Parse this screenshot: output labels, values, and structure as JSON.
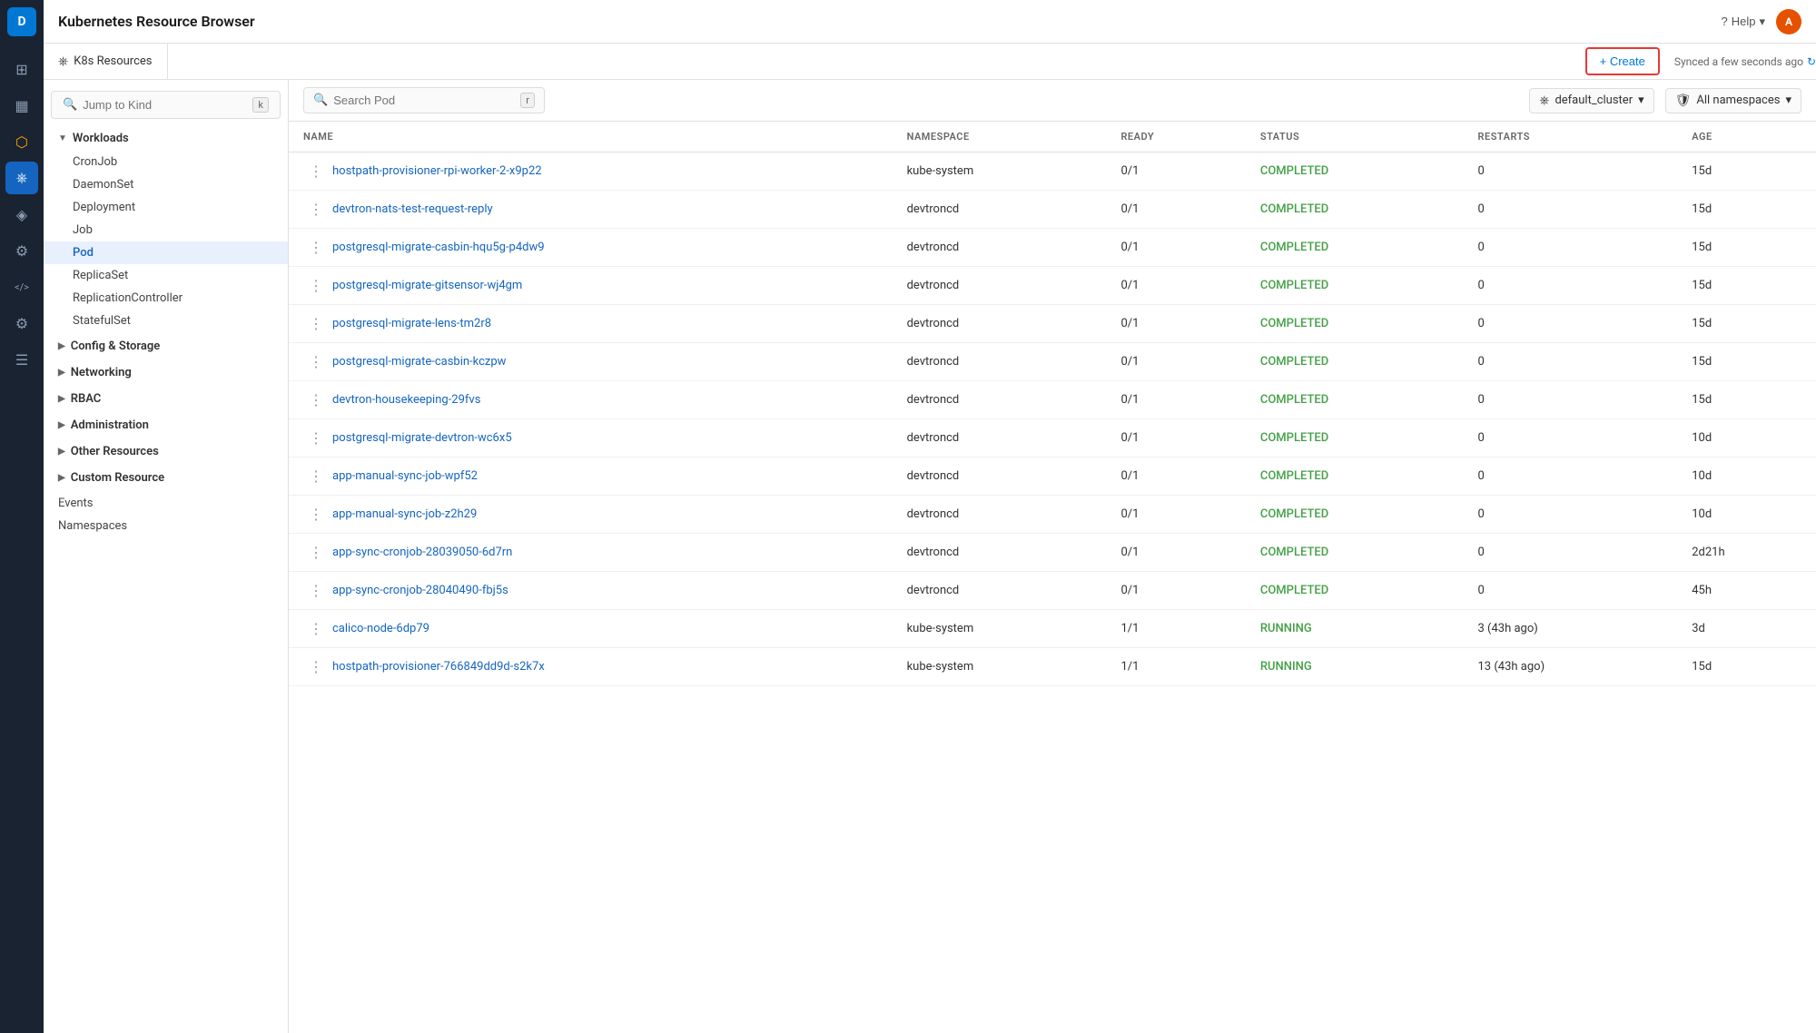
{
  "app": {
    "title": "Kubernetes Resource Browser",
    "tab_label": "K8s Resources",
    "create_label": "+ Create",
    "sync_label": "Synced a few seconds ago",
    "help_label": "Help",
    "user_initials": "A"
  },
  "icon_sidebar": {
    "logo": "D",
    "icons": [
      {
        "name": "dashboard-icon",
        "symbol": "⊞",
        "active": false
      },
      {
        "name": "chart-icon",
        "symbol": "📊",
        "active": false
      },
      {
        "name": "alert-icon",
        "symbol": "🔔",
        "active": false,
        "active_yellow": true
      },
      {
        "name": "k8s-icon",
        "symbol": "⎈",
        "active": true
      },
      {
        "name": "network-icon",
        "symbol": "⬡",
        "active": false
      },
      {
        "name": "settings-icon",
        "symbol": "⚙",
        "active": false
      },
      {
        "name": "code-icon",
        "symbol": "</>",
        "active": false
      },
      {
        "name": "config-icon",
        "symbol": "⚙",
        "active": false
      },
      {
        "name": "layers-icon",
        "symbol": "≡",
        "active": false
      }
    ]
  },
  "left_nav": {
    "search_placeholder": "Jump to Kind",
    "search_shortcut": "k",
    "workloads": {
      "label": "Workloads",
      "expanded": true,
      "items": [
        {
          "label": "CronJob",
          "active": false
        },
        {
          "label": "DaemonSet",
          "active": false
        },
        {
          "label": "Deployment",
          "active": false
        },
        {
          "label": "Job",
          "active": false
        },
        {
          "label": "Pod",
          "active": true
        },
        {
          "label": "ReplicaSet",
          "active": false
        },
        {
          "label": "ReplicationController",
          "active": false
        },
        {
          "label": "StatefulSet",
          "active": false
        }
      ]
    },
    "config_storage": {
      "label": "Config & Storage",
      "expanded": false
    },
    "networking": {
      "label": "Networking",
      "expanded": false
    },
    "rbac": {
      "label": "RBAC",
      "expanded": false
    },
    "administration": {
      "label": "Administration",
      "expanded": false
    },
    "other_resources": {
      "label": "Other Resources",
      "expanded": false
    },
    "custom_resource": {
      "label": "Custom Resource",
      "expanded": false
    },
    "bottom_items": [
      {
        "label": "Events"
      },
      {
        "label": "Namespaces"
      }
    ]
  },
  "toolbar": {
    "search_placeholder": "Search Pod",
    "search_shortcut": "r",
    "cluster": "default_cluster",
    "namespace": "All namespaces"
  },
  "table": {
    "columns": [
      "NAME",
      "NAMESPACE",
      "READY",
      "STATUS",
      "RESTARTS",
      "AGE"
    ],
    "rows": [
      {
        "name": "hostpath-provisioner-rpi-worker-2-x9p22",
        "namespace": "kube-system",
        "ready": "0/1",
        "status": "COMPLETED",
        "restarts": "0",
        "age": "15d"
      },
      {
        "name": "devtron-nats-test-request-reply",
        "namespace": "devtroncd",
        "ready": "0/1",
        "status": "COMPLETED",
        "restarts": "0",
        "age": "15d"
      },
      {
        "name": "postgresql-migrate-casbin-hqu5g-p4dw9",
        "namespace": "devtroncd",
        "ready": "0/1",
        "status": "COMPLETED",
        "restarts": "0",
        "age": "15d"
      },
      {
        "name": "postgresql-migrate-gitsensor-wj4gm",
        "namespace": "devtroncd",
        "ready": "0/1",
        "status": "COMPLETED",
        "restarts": "0",
        "age": "15d"
      },
      {
        "name": "postgresql-migrate-lens-tm2r8",
        "namespace": "devtroncd",
        "ready": "0/1",
        "status": "COMPLETED",
        "restarts": "0",
        "age": "15d"
      },
      {
        "name": "postgresql-migrate-casbin-kczpw",
        "namespace": "devtroncd",
        "ready": "0/1",
        "status": "COMPLETED",
        "restarts": "0",
        "age": "15d"
      },
      {
        "name": "devtron-housekeeping-29fvs",
        "namespace": "devtroncd",
        "ready": "0/1",
        "status": "COMPLETED",
        "restarts": "0",
        "age": "15d"
      },
      {
        "name": "postgresql-migrate-devtron-wc6x5",
        "namespace": "devtroncd",
        "ready": "0/1",
        "status": "COMPLETED",
        "restarts": "0",
        "age": "10d"
      },
      {
        "name": "app-manual-sync-job-wpf52",
        "namespace": "devtroncd",
        "ready": "0/1",
        "status": "COMPLETED",
        "restarts": "0",
        "age": "10d"
      },
      {
        "name": "app-manual-sync-job-z2h29",
        "namespace": "devtroncd",
        "ready": "0/1",
        "status": "COMPLETED",
        "restarts": "0",
        "age": "10d"
      },
      {
        "name": "app-sync-cronjob-28039050-6d7rn",
        "namespace": "devtroncd",
        "ready": "0/1",
        "status": "COMPLETED",
        "restarts": "0",
        "age": "2d21h"
      },
      {
        "name": "app-sync-cronjob-28040490-fbj5s",
        "namespace": "devtroncd",
        "ready": "0/1",
        "status": "COMPLETED",
        "restarts": "0",
        "age": "45h"
      },
      {
        "name": "calico-node-6dp79",
        "namespace": "kube-system",
        "ready": "1/1",
        "status": "RUNNING",
        "restarts": "3 (43h ago)",
        "age": "3d"
      },
      {
        "name": "hostpath-provisioner-766849dd9d-s2k7x",
        "namespace": "kube-system",
        "ready": "1/1",
        "status": "RUNNING",
        "restarts": "13 (43h ago)",
        "age": "15d"
      }
    ]
  }
}
